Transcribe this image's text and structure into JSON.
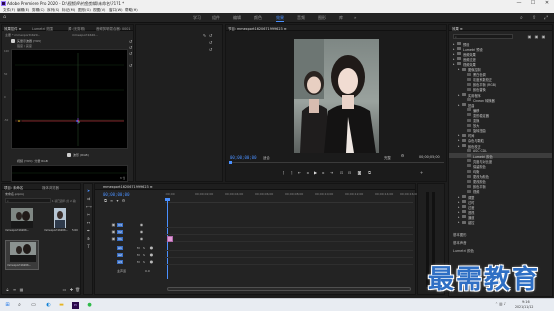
{
  "app": {
    "title": "Adobe Premiere Pro 2020 - D:\\视频\\9\\钓鱼剪辑\\未命名\\?1?1 *",
    "window_controls": [
      "—",
      "☐",
      "✕"
    ]
  },
  "menu": [
    "文件(F)",
    "编辑(E)",
    "剪辑(C)",
    "序列(S)",
    "标记(M)",
    "图形(G)",
    "视图(V)",
    "窗口(W)",
    "帮助(H)"
  ],
  "workspaces": {
    "items": [
      "学习",
      "组件",
      "编辑",
      "颜色",
      "效果",
      "音频",
      "图形",
      "库",
      "»"
    ],
    "active_index": 4
  },
  "effect_controls": {
    "tabs": [
      "效果控件 ≡",
      "Lumetri 范围",
      "源 (无剪辑)",
      "音频剪辑混合器: 0001"
    ],
    "clip_label": "主要 * mmexport1620...",
    "sequence_label": "mmexport1620...",
    "scope1_label": "矢量示波器 (YUV)",
    "scope2_label": "视频 (YUV): 分量 RGB",
    "checkbox1_label": "波形 (RGB)",
    "checkbox2_label": "波形 (RGB)",
    "mode_label": "强度 / 亮度",
    "bottom_value": "8 位",
    "scope_values": [
      "100",
      "50",
      "0",
      "-50"
    ]
  },
  "program_monitor": {
    "title": "节目: mmexport1620671999623 ≡",
    "timecode_in": "00;00;00;00",
    "fit_label": "适合",
    "quality_label": "完整",
    "timecode_out": "00;00;05;00"
  },
  "project": {
    "tabs": [
      "项目: 未命名",
      "媒体浏览器"
    ],
    "path": "未命名.prproj",
    "search_placeholder": "",
    "count_label": "1 项已选择 (共 2 项)",
    "items": [
      {
        "name": "mmexport16206...",
        "duration": "5:00"
      },
      {
        "name": "mmexport16206...",
        "duration": "5:00"
      },
      {
        "name": "mmexport16206...",
        "duration": "5:00"
      }
    ]
  },
  "timeline": {
    "tab": "mmexport1620671999623 ≡",
    "timecode": "00;00;00;00",
    "ruler": [
      ":00;00",
      "00;00;02;00",
      "00;00;04;00",
      "00;00;06;00",
      "00;00;08;00",
      "00;00;10;00",
      "00;00;12;00",
      "00;00;14;00",
      "00;00;16;00"
    ],
    "video_tracks": [
      "V3",
      "V2",
      "V1"
    ],
    "audio_tracks": [
      "A1",
      "A2",
      "A3"
    ],
    "master_label": "主声道",
    "master_value": "0.0"
  },
  "effects_panel": {
    "title": "效果 ≡",
    "search_value": "",
    "rows": [
      {
        "label": "预设",
        "indent": 0
      },
      {
        "label": "Lumetri 预设",
        "indent": 0
      },
      {
        "label": "音频效果",
        "indent": 0
      },
      {
        "label": "音频过渡",
        "indent": 0
      },
      {
        "label": "视频效果",
        "indent": 0
      },
      {
        "label": "图像控制",
        "indent": 1
      },
      {
        "label": "黑白色调",
        "indent": 2
      },
      {
        "label": "灰度系数校正",
        "indent": 2
      },
      {
        "label": "颜色平衡 (RGB)",
        "indent": 2
      },
      {
        "label": "颜色替换",
        "indent": 2
      },
      {
        "label": "实用程序",
        "indent": 1
      },
      {
        "label": "Cineon 转换器",
        "indent": 2
      },
      {
        "label": "扭曲",
        "indent": 1
      },
      {
        "label": "偏移",
        "indent": 2
      },
      {
        "label": "变形稳定器",
        "indent": 2
      },
      {
        "label": "变换",
        "indent": 2
      },
      {
        "label": "放大",
        "indent": 2
      },
      {
        "label": "旋转扭曲",
        "indent": 2
      },
      {
        "label": "时间",
        "indent": 1
      },
      {
        "label": "杂色与颗粒",
        "indent": 1
      },
      {
        "label": "颜色校正",
        "indent": 1
      },
      {
        "label": "ASC CDL",
        "indent": 2
      },
      {
        "label": "Lumetri 颜色",
        "indent": 2
      },
      {
        "label": "亮度与对比度",
        "indent": 2
      },
      {
        "label": "保留颜色",
        "indent": 2
      },
      {
        "label": "均衡",
        "indent": 2
      },
      {
        "label": "更改为颜色",
        "indent": 2
      },
      {
        "label": "更改颜色",
        "indent": 2
      },
      {
        "label": "颜色平衡",
        "indent": 2
      },
      {
        "label": "视频",
        "indent": 2
      },
      {
        "label": "调整",
        "indent": 1
      },
      {
        "label": "过时",
        "indent": 1
      },
      {
        "label": "过渡",
        "indent": 1
      },
      {
        "label": "透视",
        "indent": 1
      },
      {
        "label": "通道",
        "indent": 1
      },
      {
        "label": "键控",
        "indent": 1
      }
    ],
    "selected_index": 22,
    "sections": [
      "基本图形",
      "基本声音",
      "Lumetri 颜色"
    ]
  },
  "taskbar": {
    "time": "9:16",
    "date": "2021/11/12",
    "icons": [
      "windows-icon",
      "search-icon",
      "taskview-icon",
      "edge-icon",
      "folder-icon",
      "premiere-icon",
      "wechat-icon"
    ]
  },
  "watermark": "最需教育"
}
